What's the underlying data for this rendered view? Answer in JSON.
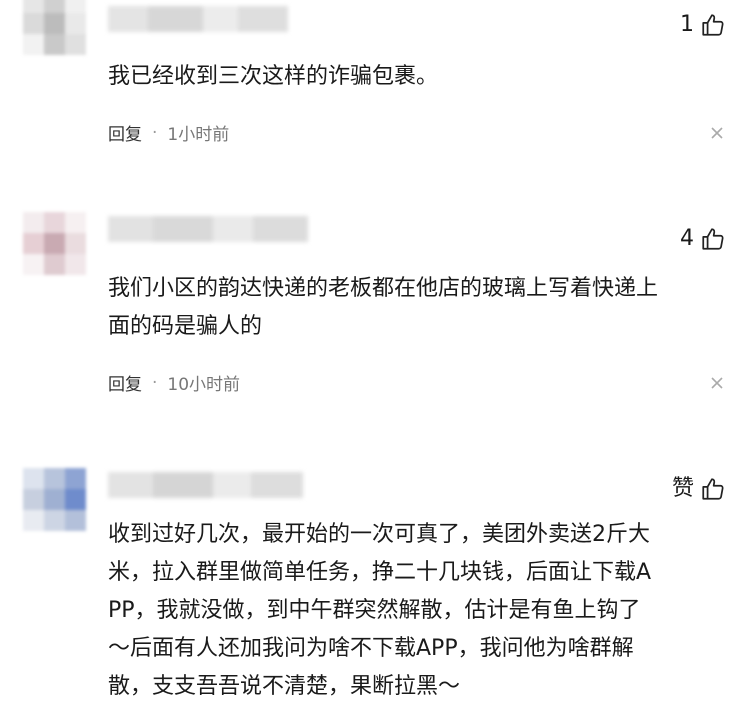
{
  "comments": [
    {
      "like_count": "1",
      "text": "我已经收到三次这样的诈骗包裹。",
      "reply_label": "回复",
      "separator": "·",
      "time": "1小时前",
      "avatar_colors": [
        "#e6e6e6",
        "#d0d0d0",
        "#f0f0f0",
        "#dadada",
        "#bcbcbc",
        "#e9e9e9",
        "#f2f2f2",
        "#c9c9c9",
        "#e0e0e0"
      ]
    },
    {
      "like_count": "4",
      "text": "我们小区的韵达快递的老板都在他店的玻璃上写着快递上\n面的码是骗人的",
      "reply_label": "回复",
      "separator": "·",
      "time": "10小时前",
      "avatar_colors": [
        "#f3ecee",
        "#e8d6db",
        "#f6f0f1",
        "#e6cfd4",
        "#c9aab2",
        "#eadcdf",
        "#f7f2f3",
        "#dfcbd0",
        "#f1e7ea"
      ]
    },
    {
      "like_count": "赞",
      "text": "收到过好几次，最开始的一次可真了，美团外卖送2斤大\n米，拉入群里做简单任务，挣二十几块钱，后面让下载A\nPP，我就没做，到中午群突然解散，估计是有鱼上钩了\n～后面有人还加我问为啥不下载APP，我问他为啥群解\n散，支支吾吾说不清楚，果断拉黑～",
      "reply_label": "",
      "separator": "",
      "time": "",
      "avatar_colors": [
        "#dde3ee",
        "#b7c4dc",
        "#8ea4d3",
        "#c7cfdf",
        "#9fb0d2",
        "#6f8ccc",
        "#e8ebf1",
        "#cdd5e4",
        "#b3c0da"
      ]
    }
  ],
  "colors": {
    "text": "#1a1a1a",
    "meta": "#777777",
    "background": "#ffffff"
  }
}
